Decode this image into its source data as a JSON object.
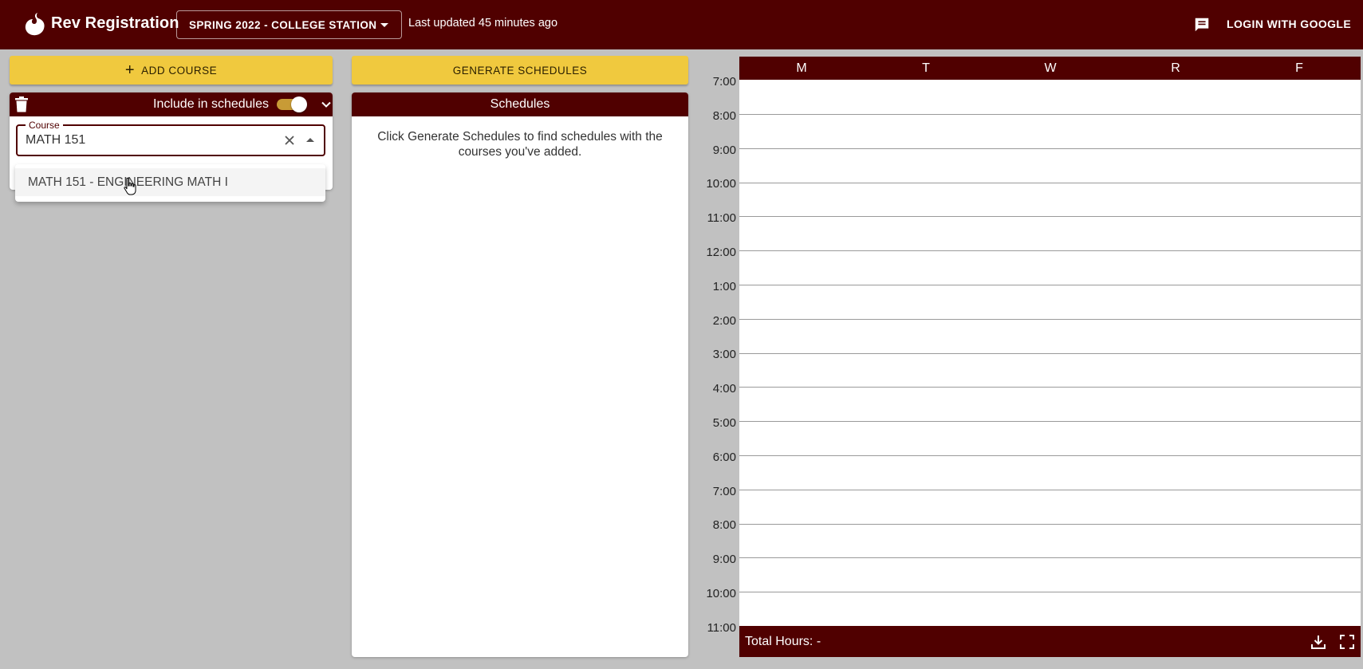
{
  "header": {
    "title": "Rev Registration",
    "term": "SPRING 2022 - COLLEGE STATION",
    "last_updated": "Last updated 45 minutes ago",
    "login": "LOGIN WITH GOOGLE",
    "icons": [
      "logo-icon",
      "feedback-icon"
    ]
  },
  "actions": {
    "add_course": "ADD COURSE",
    "generate": "GENERATE SCHEDULES"
  },
  "course_card": {
    "include_label": "Include in schedules",
    "include_on": true,
    "field_label": "Course",
    "field_value": "MATH 151",
    "suggestions": [
      "MATH 151 - ENGINEERING MATH I"
    ]
  },
  "schedules": {
    "title": "Schedules",
    "message": "Click Generate Schedules to find schedules with the courses you've added."
  },
  "calendar": {
    "days": [
      "M",
      "T",
      "W",
      "R",
      "F"
    ],
    "times": [
      "7:00",
      "8:00",
      "9:00",
      "10:00",
      "11:00",
      "12:00",
      "1:00",
      "2:00",
      "3:00",
      "4:00",
      "5:00",
      "6:00",
      "7:00",
      "8:00",
      "9:00",
      "10:00",
      "11:00"
    ],
    "total_hours": "Total Hours: -"
  },
  "colors": {
    "maroon": "#500000",
    "gold": "#f0c93e",
    "toggle": "#c89b36",
    "background": "#c1c1c1"
  }
}
